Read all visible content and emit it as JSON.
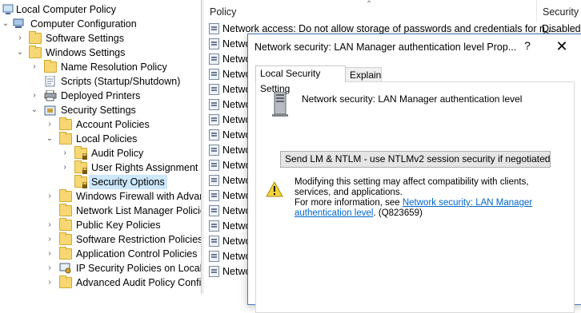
{
  "tree": {
    "items": [
      {
        "label": "Local Computer Policy",
        "icon": "computer-policy-icon"
      },
      {
        "label": "Computer Configuration",
        "icon": "computer-icon"
      },
      {
        "label": "Software Settings",
        "icon": "folder-icon"
      },
      {
        "label": "Windows Settings",
        "icon": "folder-icon"
      },
      {
        "label": "Name Resolution Policy",
        "icon": "folder-icon"
      },
      {
        "label": "Scripts (Startup/Shutdown)",
        "icon": "script-icon"
      },
      {
        "label": "Deployed Printers",
        "icon": "printer-icon"
      },
      {
        "label": "Security Settings",
        "icon": "security-settings-icon"
      },
      {
        "label": "Account Policies",
        "icon": "folder-icon"
      },
      {
        "label": "Local Policies",
        "icon": "folder-icon"
      },
      {
        "label": "Audit Policy",
        "icon": "locked-folder-icon"
      },
      {
        "label": "User Rights Assignment",
        "icon": "locked-folder-icon"
      },
      {
        "label": "Security Options",
        "icon": "locked-folder-icon"
      },
      {
        "label": "Windows Firewall with Advan",
        "icon": "folder-icon"
      },
      {
        "label": "Network List Manager Policie",
        "icon": "folder-icon"
      },
      {
        "label": "Public Key Policies",
        "icon": "folder-icon"
      },
      {
        "label": "Software Restriction Policies",
        "icon": "folder-icon"
      },
      {
        "label": "Application Control Policies",
        "icon": "folder-icon"
      },
      {
        "label": "IP Security Policies on Local C",
        "icon": "ip-security-icon"
      },
      {
        "label": "Advanced Audit Policy Confi",
        "icon": "folder-icon"
      }
    ]
  },
  "list": {
    "col_policy": "Policy",
    "col_security": "Security S",
    "first_row": "Network access: Do not allow storage of passwords and credentials for n...",
    "first_row_value": "Disabled",
    "row_prefix": "Netwo",
    "row_count": 16
  },
  "dialog": {
    "title": "Network security: LAN Manager authentication level Prop...",
    "help": "?",
    "close": "✕",
    "tabs": [
      "Local Security Setting",
      "Explain"
    ],
    "setting_title": "Network security: LAN Manager authentication level",
    "dropdown_value": "Send LM & NTLM - use NTLMv2 session security if negotiated",
    "warning_line1": "Modifying this setting may affect compatibility with clients, services, and applications.",
    "warning_line2_prefix": "For more information, see ",
    "warning_link": "Network security: LAN Manager authentication level",
    "warning_suffix": ". (Q823659)"
  }
}
